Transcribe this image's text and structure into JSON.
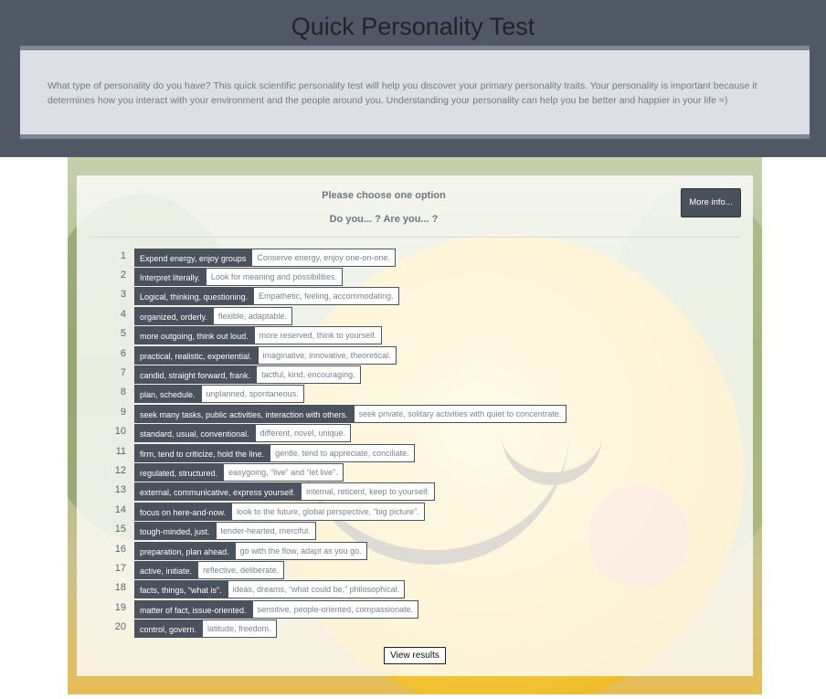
{
  "header": {
    "title": "Quick Personality Test",
    "intro": "What type of personality do you have? This quick scientific personality test will help you discover your primary personality traits. Your personality is important because it determines how you interact with your environment and the people around you. Understanding your personality can help you be better and happier in your life =)"
  },
  "panel": {
    "instruction": "Please choose one option",
    "question": "Do you... ? Are you... ?",
    "more_info_label": "More info...",
    "view_results_label": "View results"
  },
  "items": [
    {
      "num": "1",
      "a": "Expend energy, enjoy groups",
      "b": "Conserve energy, enjoy one-on-one."
    },
    {
      "num": "2",
      "a": "Interpret literally.",
      "b": "Look for meaning and possibilities."
    },
    {
      "num": "3",
      "a": "Logical, thinking, questioning.",
      "b": "Empathetic, feeling, accommodating."
    },
    {
      "num": "4",
      "a": "organized, orderly.",
      "b": "flexible, adaptable."
    },
    {
      "num": "5",
      "a": "more outgoing, think out loud.",
      "b": "more reserved, think to yourself."
    },
    {
      "num": "6",
      "a": "practical, realistic, experiential.",
      "b": "imaginative, innovative, theoretical."
    },
    {
      "num": "7",
      "a": "candid, straight forward, frank.",
      "b": "tactful, kind, encouraging."
    },
    {
      "num": "8",
      "a": "plan, schedule.",
      "b": "unplanned, spontaneous."
    },
    {
      "num": "9",
      "a": "seek many tasks, public activities, interaction with others.",
      "b": "seek private, solitary activities with quiet to concentrate."
    },
    {
      "num": "10",
      "a": "standard, usual, conventional.",
      "b": "different, novel, unique."
    },
    {
      "num": "11",
      "a": "firm, tend to criticize, hold the line.",
      "b": "gentle, tend to appreciate, conciliate."
    },
    {
      "num": "12",
      "a": "regulated, structured.",
      "b": "easygoing, “live” and “let live”."
    },
    {
      "num": "13",
      "a": "external, communicative, express yourself.",
      "b": "internal, reticent, keep to yourself."
    },
    {
      "num": "14",
      "a": "focus on here-and-now.",
      "b": "look to the future, global perspective, “big picture”."
    },
    {
      "num": "15",
      "a": "tough-minded, just.",
      "b": "tender-hearted, merciful."
    },
    {
      "num": "16",
      "a": "preparation, plan ahead.",
      "b": "go with the flow, adapt as you go."
    },
    {
      "num": "17",
      "a": "active, initiate.",
      "b": "reflective, deliberate."
    },
    {
      "num": "18",
      "a": "facts, things, “what is”.",
      "b": "ideas, dreams, “what could be,” philosophical."
    },
    {
      "num": "19",
      "a": "matter of fact, issue-oriented.",
      "b": "sensitive, people-oriented, compassionate."
    },
    {
      "num": "20",
      "a": "control, govern.",
      "b": "latitude, freedom."
    }
  ]
}
